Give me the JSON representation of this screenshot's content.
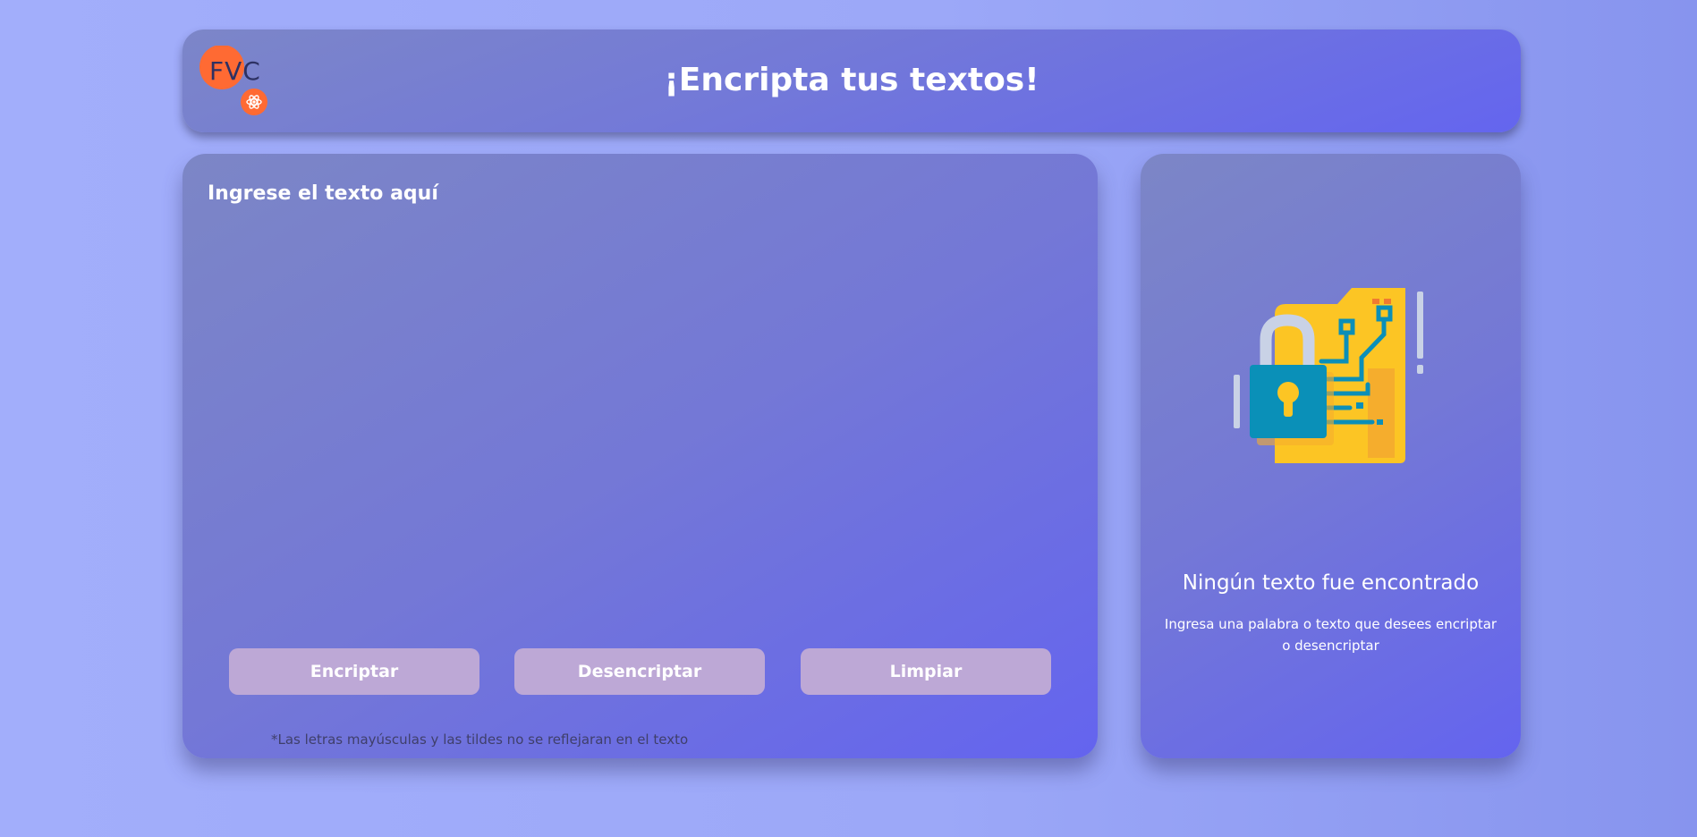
{
  "header": {
    "logo_text": "FVC",
    "title": "¡Encripta tus textos!"
  },
  "input": {
    "placeholder": "Ingrese el texto aquí",
    "value": ""
  },
  "buttons": {
    "encrypt": "Encriptar",
    "decrypt": "Desencriptar",
    "clear": "Limpiar"
  },
  "note": "*Las letras mayúsculas y las tildes no se reflejaran en el texto",
  "output": {
    "empty_title": "Ningún texto fue encontrado",
    "empty_description": "Ingresa una palabra o texto que desees encriptar o desencriptar",
    "illustration_icon": "padlock-circuit-folder-icon"
  },
  "colors": {
    "accent_orange": "#ff6a33",
    "button_bg": "#bda8d6",
    "panel_start": "#7c86c6",
    "panel_end": "#6464ef"
  }
}
